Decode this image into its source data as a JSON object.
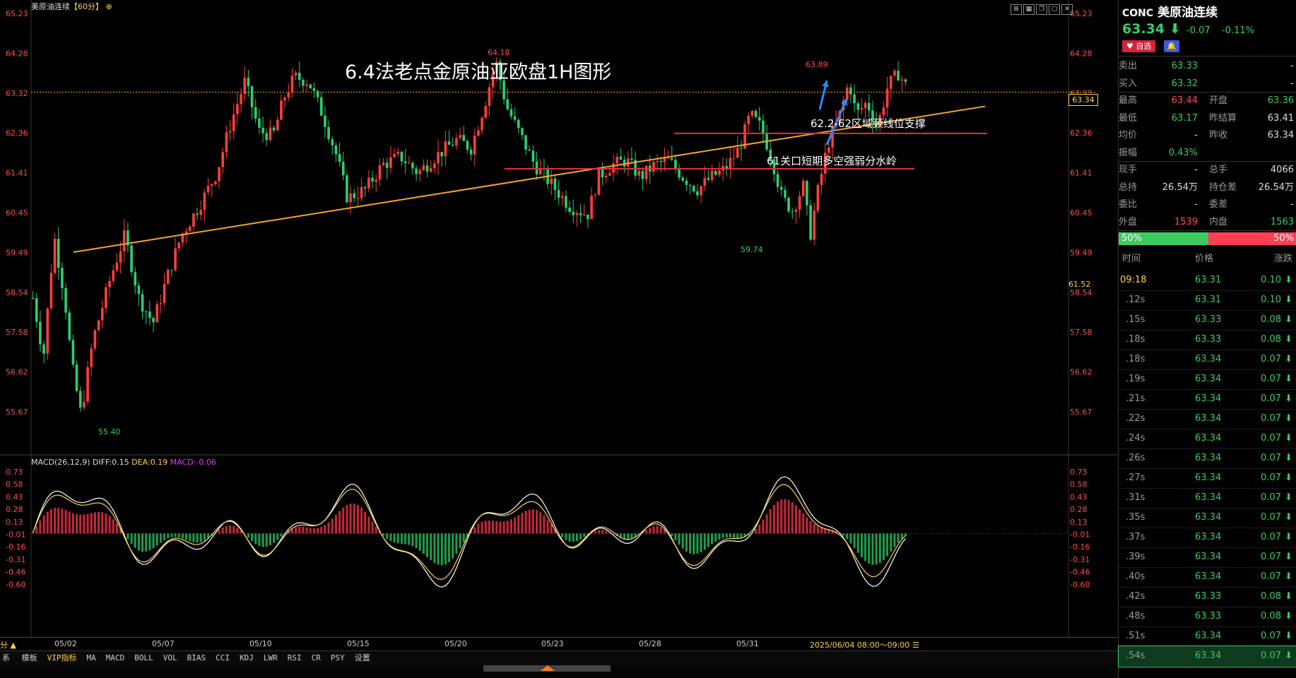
{
  "header": {
    "symbol_title": "美原油连续",
    "period": "【60分】",
    "overlay_title": "6.4法老点金原油亚欧盘1H图形"
  },
  "toolbar_icons": [
    "maximize-icon",
    "layout-icon",
    "copy-icon",
    "window-icon",
    "close-icon"
  ],
  "main_chart": {
    "y_ticks": [
      "65.23",
      "64.28",
      "63.32",
      "62.36",
      "61.41",
      "60.45",
      "59.49",
      "58.54",
      "57.58",
      "56.62",
      "55.67"
    ],
    "last_price_tag": "63.34",
    "secondary_tag": "61.52",
    "high_label": "64.18",
    "high2_label": "63.89",
    "low_label": "55.40",
    "low2_label": "59.74",
    "annotation_1": "62.2-62区域颈线位支撑",
    "annotation_2": "61关口短期多空强弱分水岭"
  },
  "macd": {
    "title": "MACD(26,12,9)",
    "diff_label": "DIFF:0.15",
    "dea_label": "DEA:0.19",
    "macd_label": "MACD:-0.06",
    "y_ticks": [
      "0.73",
      "0.58",
      "0.43",
      "0.28",
      "0.13",
      "-0.01",
      "-0.16",
      "-0.31",
      "-0.46",
      "-0.60"
    ]
  },
  "x_axis": {
    "dates": [
      "05/02",
      "05/07",
      "05/10",
      "05/15",
      "05/20",
      "05/23",
      "05/28",
      "05/31"
    ],
    "current_range": "2025/06/04 08:00～09:00",
    "left_marker": "分 ▲"
  },
  "indicator_tabs": [
    "模板",
    "VIP指标",
    "MA",
    "MACD",
    "BOLL",
    "VOL",
    "BIAS",
    "CCI",
    "KDJ",
    "LWR",
    "RSI",
    "CR",
    "PSY",
    "设置"
  ],
  "indicator_tab_prefix": "系",
  "quote": {
    "code": "CONC",
    "name": "美原油连续",
    "price": "63.34",
    "change": "-0.07",
    "change_pct": "-0.11%",
    "fav_label": "自选",
    "rows": [
      {
        "l1": "卖出",
        "v1": "63.33",
        "v1c": "green",
        "l2": "",
        "v2": "-",
        "v2c": "white"
      },
      {
        "l1": "买入",
        "v1": "63.32",
        "v1c": "green",
        "l2": "",
        "v2": "-",
        "v2c": "white"
      },
      {
        "l1": "最高",
        "v1": "63.44",
        "v1c": "red",
        "l2": "开盘",
        "v2": "63.36",
        "v2c": "green"
      },
      {
        "l1": "最低",
        "v1": "63.17",
        "v1c": "green",
        "l2": "昨结算",
        "v2": "63.41",
        "v2c": "white"
      },
      {
        "l1": "均价",
        "v1": "-",
        "v1c": "white",
        "l2": "昨收",
        "v2": "63.34",
        "v2c": "white"
      },
      {
        "l1": "振幅",
        "v1": "0.43%",
        "v1c": "green",
        "l2": "",
        "v2": "",
        "v2c": "white"
      },
      {
        "l1": "现手",
        "v1": "-",
        "v1c": "white",
        "l2": "总手",
        "v2": "4066",
        "v2c": "white"
      },
      {
        "l1": "总持",
        "v1": "26.54万",
        "v1c": "white",
        "l2": "持仓差",
        "v2": "26.54万",
        "v2c": "white"
      },
      {
        "l1": "委比",
        "v1": "-",
        "v1c": "white",
        "l2": "委差",
        "v2": "-",
        "v2c": "white"
      },
      {
        "l1": "外盘",
        "v1": "1539",
        "v1c": "red",
        "l2": "内盘",
        "v2": "1563",
        "v2c": "green"
      }
    ],
    "bar_left": "50%",
    "bar_right": "50%",
    "ticks_header": {
      "time": "时间",
      "price": "价格",
      "chg": "涨跌"
    },
    "ticks": [
      {
        "t": "09:18",
        "p": "63.31",
        "c": "0.10"
      },
      {
        "t": ".12s",
        "p": "63.31",
        "c": "0.10"
      },
      {
        "t": ".15s",
        "p": "63.33",
        "c": "0.08"
      },
      {
        "t": ".18s",
        "p": "63.33",
        "c": "0.08"
      },
      {
        "t": ".18s",
        "p": "63.34",
        "c": "0.07"
      },
      {
        "t": ".19s",
        "p": "63.34",
        "c": "0.07"
      },
      {
        "t": ".21s",
        "p": "63.34",
        "c": "0.07"
      },
      {
        "t": ".22s",
        "p": "63.34",
        "c": "0.07"
      },
      {
        "t": ".24s",
        "p": "63.34",
        "c": "0.07"
      },
      {
        "t": ".26s",
        "p": "63.34",
        "c": "0.07"
      },
      {
        "t": ".27s",
        "p": "63.34",
        "c": "0.07"
      },
      {
        "t": ".31s",
        "p": "63.34",
        "c": "0.07"
      },
      {
        "t": ".35s",
        "p": "63.34",
        "c": "0.07"
      },
      {
        "t": ".37s",
        "p": "63.34",
        "c": "0.07"
      },
      {
        "t": ".39s",
        "p": "63.34",
        "c": "0.07"
      },
      {
        "t": ".40s",
        "p": "63.34",
        "c": "0.07"
      },
      {
        "t": ".42s",
        "p": "63.33",
        "c": "0.08"
      },
      {
        "t": ".48s",
        "p": "63.33",
        "c": "0.08"
      },
      {
        "t": ".51s",
        "p": "63.34",
        "c": "0.07"
      },
      {
        "t": ".54s",
        "p": "63.34",
        "c": "0.07"
      }
    ]
  },
  "colors": {
    "up": "#ff3d3d",
    "down": "#2ecc71",
    "trend": "#f5a623",
    "level": "#e0303a",
    "arrow": "#1e8fff"
  }
}
